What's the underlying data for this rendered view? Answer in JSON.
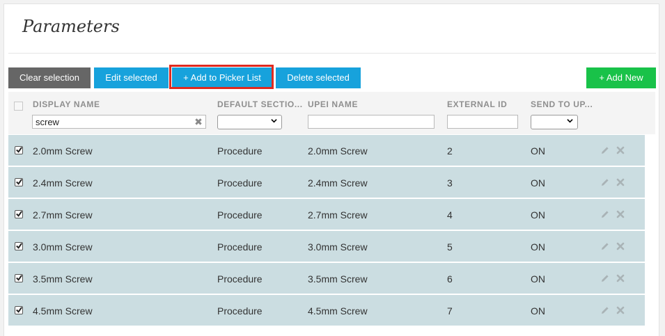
{
  "page": {
    "title": "Parameters"
  },
  "toolbar": {
    "clear_selection": "Clear selection",
    "edit_selected": "Edit selected",
    "add_to_picker_list": "+ Add to Picker List",
    "delete_selected": "Delete selected",
    "add_new": "+ Add New"
  },
  "colors": {
    "primary_button": "#17a2dc",
    "add_new_button": "#19c249",
    "clear_button": "#666666",
    "highlight_frame": "#e02a1f",
    "selected_row": "#cbdde1"
  },
  "table": {
    "columns": [
      "DISPLAY NAME",
      "DEFAULT SECTIO...",
      "UPEI NAME",
      "EXTERNAL ID",
      "SEND TO UP..."
    ],
    "filters": {
      "display_name": "screw",
      "default_section": "",
      "upei_name": "",
      "external_id": "",
      "send_to_upei": ""
    },
    "rows": [
      {
        "display_name": "2.0mm Screw",
        "default_section": "Procedure",
        "upei_name": "2.0mm Screw",
        "external_id": "2",
        "send_to_upei": "ON",
        "checked": true
      },
      {
        "display_name": "2.4mm Screw",
        "default_section": "Procedure",
        "upei_name": "2.4mm Screw",
        "external_id": "3",
        "send_to_upei": "ON",
        "checked": true
      },
      {
        "display_name": "2.7mm Screw",
        "default_section": "Procedure",
        "upei_name": "2.7mm Screw",
        "external_id": "4",
        "send_to_upei": "ON",
        "checked": true
      },
      {
        "display_name": "3.0mm Screw",
        "default_section": "Procedure",
        "upei_name": "3.0mm Screw",
        "external_id": "5",
        "send_to_upei": "ON",
        "checked": true
      },
      {
        "display_name": "3.5mm Screw",
        "default_section": "Procedure",
        "upei_name": "3.5mm Screw",
        "external_id": "6",
        "send_to_upei": "ON",
        "checked": true
      },
      {
        "display_name": "4.5mm Screw",
        "default_section": "Procedure",
        "upei_name": "4.5mm Screw",
        "external_id": "7",
        "send_to_upei": "ON",
        "checked": true
      }
    ],
    "row_icons": [
      "pencil-icon",
      "delete-x-icon"
    ]
  }
}
